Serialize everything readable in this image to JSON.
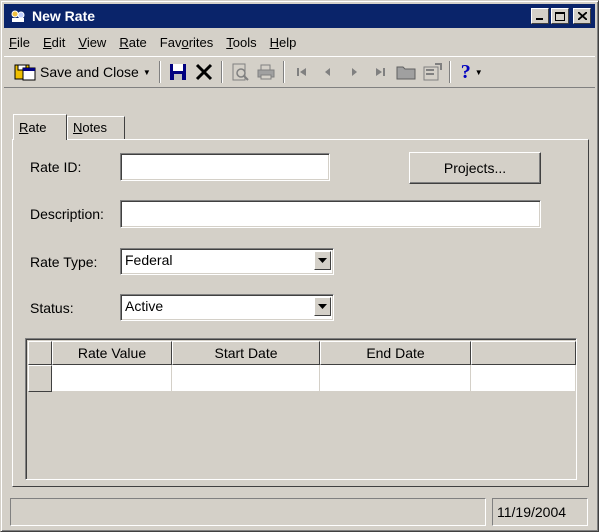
{
  "window": {
    "title": "New Rate"
  },
  "menu": [
    {
      "label": "File",
      "u": "F",
      "rest": "ile"
    },
    {
      "label": "Edit",
      "u": "E",
      "rest": "dit"
    },
    {
      "label": "View",
      "u": "V",
      "rest": "iew"
    },
    {
      "label": "Rate",
      "u": "R",
      "rest": "ate"
    },
    {
      "label": "Favorites",
      "pre": "Fav",
      "u": "o",
      "rest": "rites"
    },
    {
      "label": "Tools",
      "u": "T",
      "rest": "ools"
    },
    {
      "label": "Help",
      "u": "H",
      "rest": "elp"
    }
  ],
  "toolbar": {
    "save_close_label": "Save and Close"
  },
  "tabs": [
    {
      "label": "Rate",
      "u": "R",
      "rest": "ate"
    },
    {
      "label": "Notes",
      "u": "N",
      "rest": "otes"
    }
  ],
  "form": {
    "rate_id_label": "Rate ID:",
    "rate_id_value": "",
    "projects_button": "Projects...",
    "description_label": "Description:",
    "description_value": "",
    "rate_type_label": "Rate Type:",
    "rate_type_value": "Federal",
    "status_label": "Status:",
    "status_value": "Active"
  },
  "grid": {
    "columns": [
      "Rate Value",
      "Start Date",
      "End Date"
    ]
  },
  "statusbar": {
    "date": "11/19/2004"
  }
}
